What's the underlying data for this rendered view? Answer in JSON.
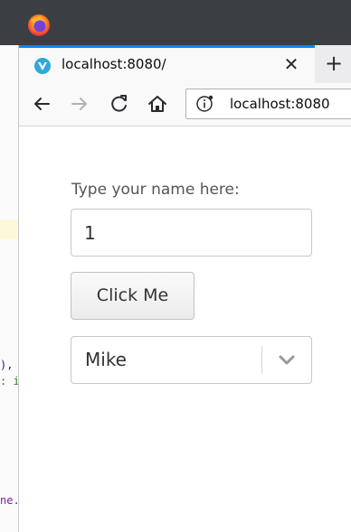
{
  "background_editor": {
    "fragments": [
      {
        "text": "),",
        "color": "#1a1aa6"
      },
      {
        "text": ": i",
        "color": "#2e7d32"
      },
      {
        "text": "ne.",
        "color": "#7b1fa2"
      }
    ]
  },
  "browser": {
    "app_icon": "firefox-icon",
    "tab": {
      "title": "localhost:8080/",
      "favicon": "vue-shield-icon",
      "close_glyph": "✕"
    },
    "new_tab_glyph": "+",
    "nav": {
      "back_icon": "back-arrow-icon",
      "forward_icon": "forward-arrow-icon",
      "reload_icon": "reload-icon",
      "home_icon": "home-icon"
    },
    "url": "localhost:8080"
  },
  "form": {
    "label": "Type your name here:",
    "input_value": "1",
    "button_label": "Click Me",
    "select_value": "Mike"
  },
  "colors": {
    "accent": "#0a84ff",
    "titlebar": "#3b3f44"
  }
}
